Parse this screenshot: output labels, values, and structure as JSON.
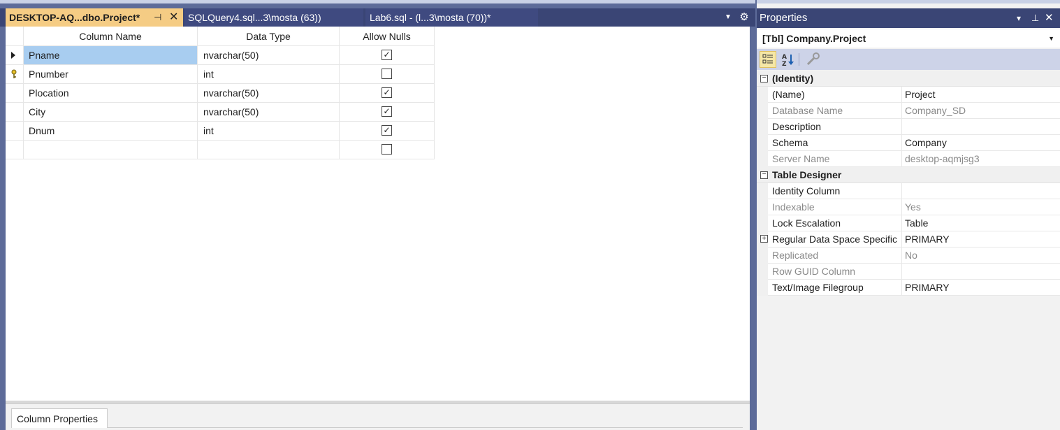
{
  "tabs": {
    "active": {
      "label": "DESKTOP-AQ...dbo.Project*",
      "pin": "⊣",
      "close": "✕"
    },
    "second": {
      "label": "SQLQuery4.sql...3\\mosta (63))"
    },
    "third": {
      "label": "Lab6.sql - (l...3\\mosta (70))*"
    }
  },
  "grid": {
    "headers": [
      "Column Name",
      "Data Type",
      "Allow Nulls"
    ],
    "rows": [
      {
        "name": "Pname",
        "type": "nvarchar(50)",
        "allow_nulls": true,
        "current": true,
        "primary_key": false
      },
      {
        "name": "Pnumber",
        "type": "int",
        "allow_nulls": false,
        "current": false,
        "primary_key": true
      },
      {
        "name": "Plocation",
        "type": "nvarchar(50)",
        "allow_nulls": true,
        "current": false,
        "primary_key": false
      },
      {
        "name": "City",
        "type": "nvarchar(50)",
        "allow_nulls": true,
        "current": false,
        "primary_key": false
      },
      {
        "name": "Dnum",
        "type": "int",
        "allow_nulls": true,
        "current": false,
        "primary_key": false
      },
      {
        "name": "",
        "type": "",
        "allow_nulls": false,
        "current": false,
        "primary_key": false
      }
    ]
  },
  "bottom_pane": {
    "tab_label": "Column Properties"
  },
  "properties": {
    "title": "Properties",
    "object": "[Tbl] Company.Project",
    "categories": [
      {
        "label": "(Identity)",
        "toggle": "−",
        "items": [
          {
            "name": "(Name)",
            "value": "Project",
            "dim": false,
            "expandable": false
          },
          {
            "name": "Database Name",
            "value": "Company_SD",
            "dim": true,
            "expandable": false
          },
          {
            "name": "Description",
            "value": "",
            "dim": false,
            "expandable": false
          },
          {
            "name": "Schema",
            "value": "Company",
            "dim": false,
            "expandable": false
          },
          {
            "name": "Server Name",
            "value": "desktop-aqmjsg3",
            "dim": true,
            "expandable": false
          }
        ]
      },
      {
        "label": "Table Designer",
        "toggle": "−",
        "items": [
          {
            "name": "Identity Column",
            "value": "",
            "dim": false,
            "expandable": false
          },
          {
            "name": "Indexable",
            "value": "Yes",
            "dim": true,
            "expandable": false
          },
          {
            "name": "Lock Escalation",
            "value": "Table",
            "dim": false,
            "expandable": false
          },
          {
            "name": "Regular Data Space Specific",
            "value": "PRIMARY",
            "dim": false,
            "expandable": true
          },
          {
            "name": "Replicated",
            "value": "No",
            "dim": true,
            "expandable": false
          },
          {
            "name": "Row GUID Column",
            "value": "",
            "dim": true,
            "expandable": false
          },
          {
            "name": "Text/Image Filegroup",
            "value": "PRIMARY",
            "dim": false,
            "expandable": false
          }
        ]
      }
    ]
  },
  "colors": {
    "active_tab": "#f5cc84",
    "chrome": "#3a4575",
    "selection": "#a8cdf0"
  },
  "icons": [
    "pin-icon",
    "close-icon",
    "dropdown-icon",
    "gear-icon",
    "key-icon",
    "row-arrow-icon",
    "categorized-icon",
    "alphabetical-icon",
    "property-pages-icon",
    "checkbox-icon"
  ]
}
